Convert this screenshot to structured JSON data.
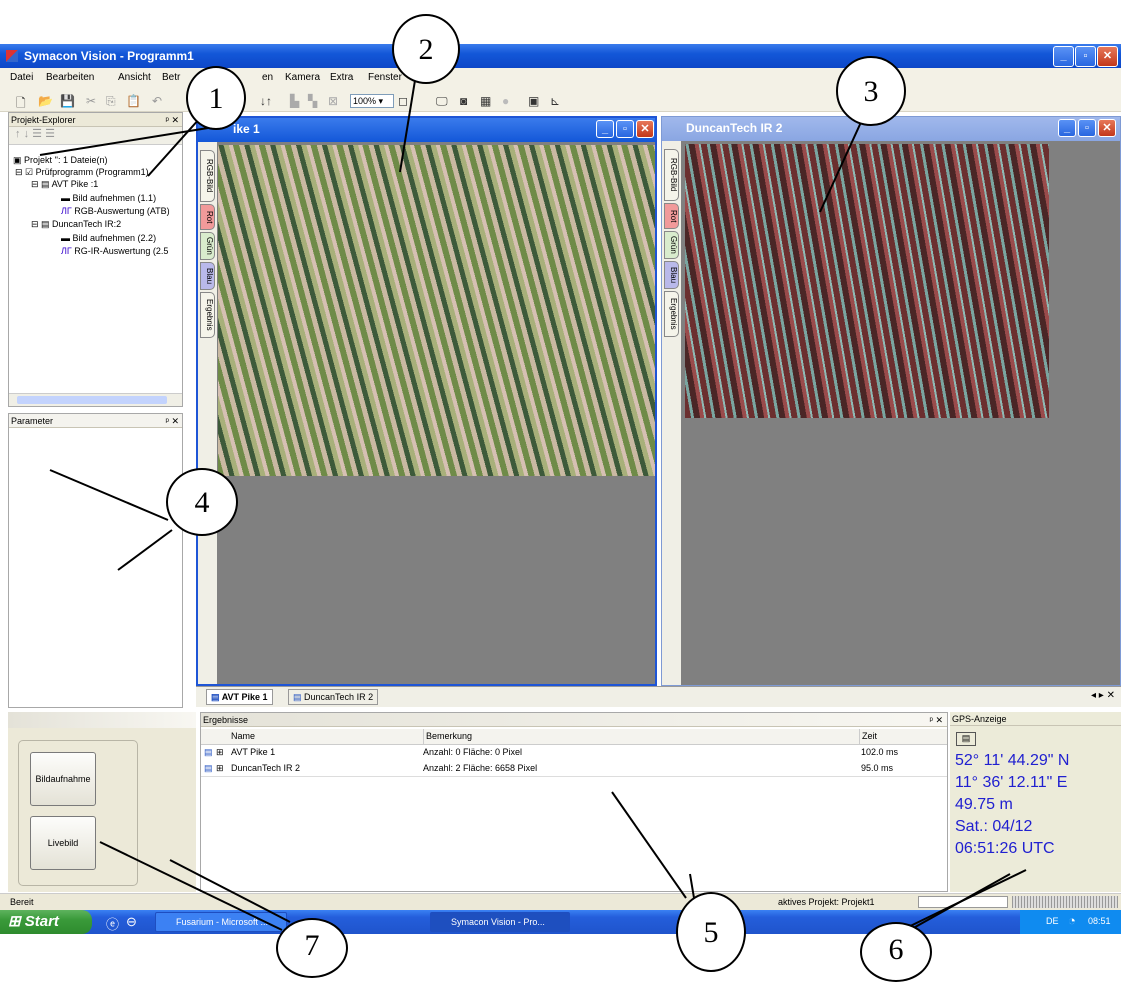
{
  "app": {
    "title": "Symacon Vision - Programm1"
  },
  "menu": [
    "Datei",
    "Bearbeiten",
    "Ansicht",
    "Betr",
    "en",
    "Kamera",
    "Extra",
    "Fenster"
  ],
  "toolbar": {
    "zoom": "100%"
  },
  "explorer": {
    "title": "Projekt-Explorer",
    "items": [
      "Projekt '': 1 Dateie(n)",
      "Prüfprogramm (Programm1)",
      "AVT Pike :1",
      "Bild aufnehmen (1.1)",
      "RGB-Auswertung (ATB)",
      "DuncanTech IR:2",
      "Bild aufnehmen (2.2)",
      "RG-IR-Auswertung (2.5"
    ]
  },
  "parameter": {
    "title": "Parameter"
  },
  "doc1": {
    "title": "ike 1",
    "tabs": [
      "RGB-Bild",
      "Rot",
      "Grün",
      "Blau",
      "Ergebnis"
    ]
  },
  "doc2": {
    "title": "DuncanTech IR 2",
    "tabs": [
      "RGB-Bild",
      "Rot",
      "Grün",
      "Blau",
      "Ergebnis"
    ]
  },
  "doc_tabs": [
    "AVT Pike 1",
    "DuncanTech IR 2"
  ],
  "controls": {
    "btn_capture": "Bildaufnahme",
    "btn_live": "Livebild"
  },
  "results": {
    "title": "Ergebnisse",
    "columns": [
      "Name",
      "Bemerkung",
      "Zeit"
    ],
    "rows": [
      [
        "AVT Pike 1",
        "Anzahl: 0  Fläche:    0 Pixel",
        "102.0 ms"
      ],
      [
        "DuncanTech IR 2",
        "Anzahl: 2  Fläche: 6658 Pixel",
        "95.0 ms"
      ]
    ]
  },
  "gps": {
    "title": "GPS-Anzeige",
    "lat": "52° 11' 44.29\" N",
    "lon": "11° 36' 12.11\" E",
    "alt": "49.75 m",
    "sat": "Sat.: 04/12",
    "time": "06:51:26 UTC"
  },
  "statusbar": {
    "left": "Bereit",
    "project": "aktives Projekt:  Projekt1"
  },
  "taskbar": {
    "start": "Start",
    "items": [
      "Fusarium - Microsoft ...",
      "Symacon Vision - Pro..."
    ],
    "lang": "DE",
    "clock": "08:51"
  },
  "callouts": [
    "1",
    "2",
    "3",
    "4",
    "5",
    "6",
    "7"
  ],
  "colors": {
    "title_blue": "#1357d8",
    "gps_text": "#2020d0",
    "taskbar_blue": "#245edb",
    "start_green": "#3a9a3a"
  }
}
